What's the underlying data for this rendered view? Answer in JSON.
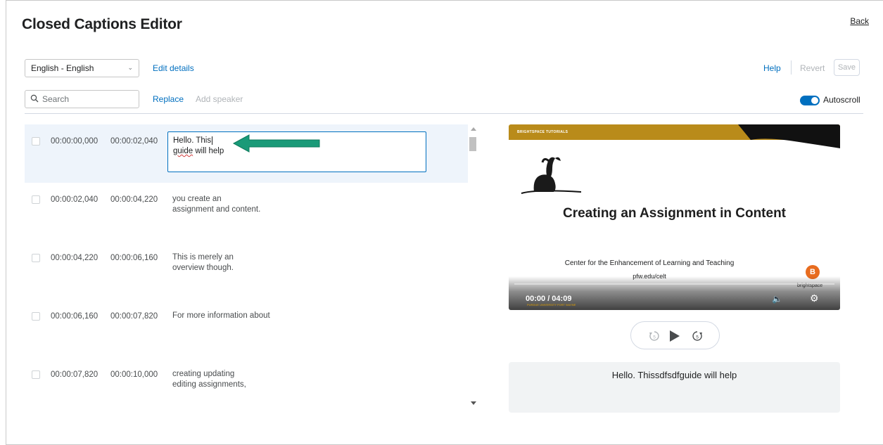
{
  "header": {
    "title": "Closed Captions Editor",
    "back_label": "Back"
  },
  "toolbar": {
    "language_selected": "English - English",
    "edit_details_label": "Edit details",
    "help_label": "Help",
    "revert_label": "Revert",
    "save_label": "Save",
    "search_placeholder": "Search",
    "replace_label": "Replace",
    "add_speaker_label": "Add speaker",
    "autoscroll_label": "Autoscroll",
    "autoscroll_on": true
  },
  "cues": [
    {
      "start": "00:00:00,000",
      "end": "00:00:02,040",
      "line1": "Hello. This",
      "line2_underlined": "guide",
      "line2_rest": " will help",
      "active": true
    },
    {
      "start": "00:00:02,040",
      "end": "00:00:04,220",
      "text": "you create an\nassignment and content."
    },
    {
      "start": "00:00:04,220",
      "end": "00:00:06,160",
      "text": "This is merely an\noverview though."
    },
    {
      "start": "00:00:06,160",
      "end": "00:00:07,820",
      "text": "For more information about"
    },
    {
      "start": "00:00:07,820",
      "end": "00:00:10,000",
      "text": "creating updating\nediting assignments,"
    }
  ],
  "video": {
    "band_label": "BRIGHTSPACE TUTORIALS",
    "title": "Creating an Assignment in Content",
    "center_text": "Center for the Enhancement of Learning and Teaching",
    "url_text": "pfw.edu/celt",
    "time": "00:00 / 04:09",
    "brand_badge": "B",
    "brand_text": "brightspace",
    "footer_text": "PURDUE UNIVERSITY FORT WAYNE"
  },
  "preview": {
    "text": "Hello. Thissdfsdfguide will help"
  },
  "colors": {
    "accent": "#006fbf",
    "arrow": "#1a9a78",
    "gold": "#b98b1a"
  }
}
